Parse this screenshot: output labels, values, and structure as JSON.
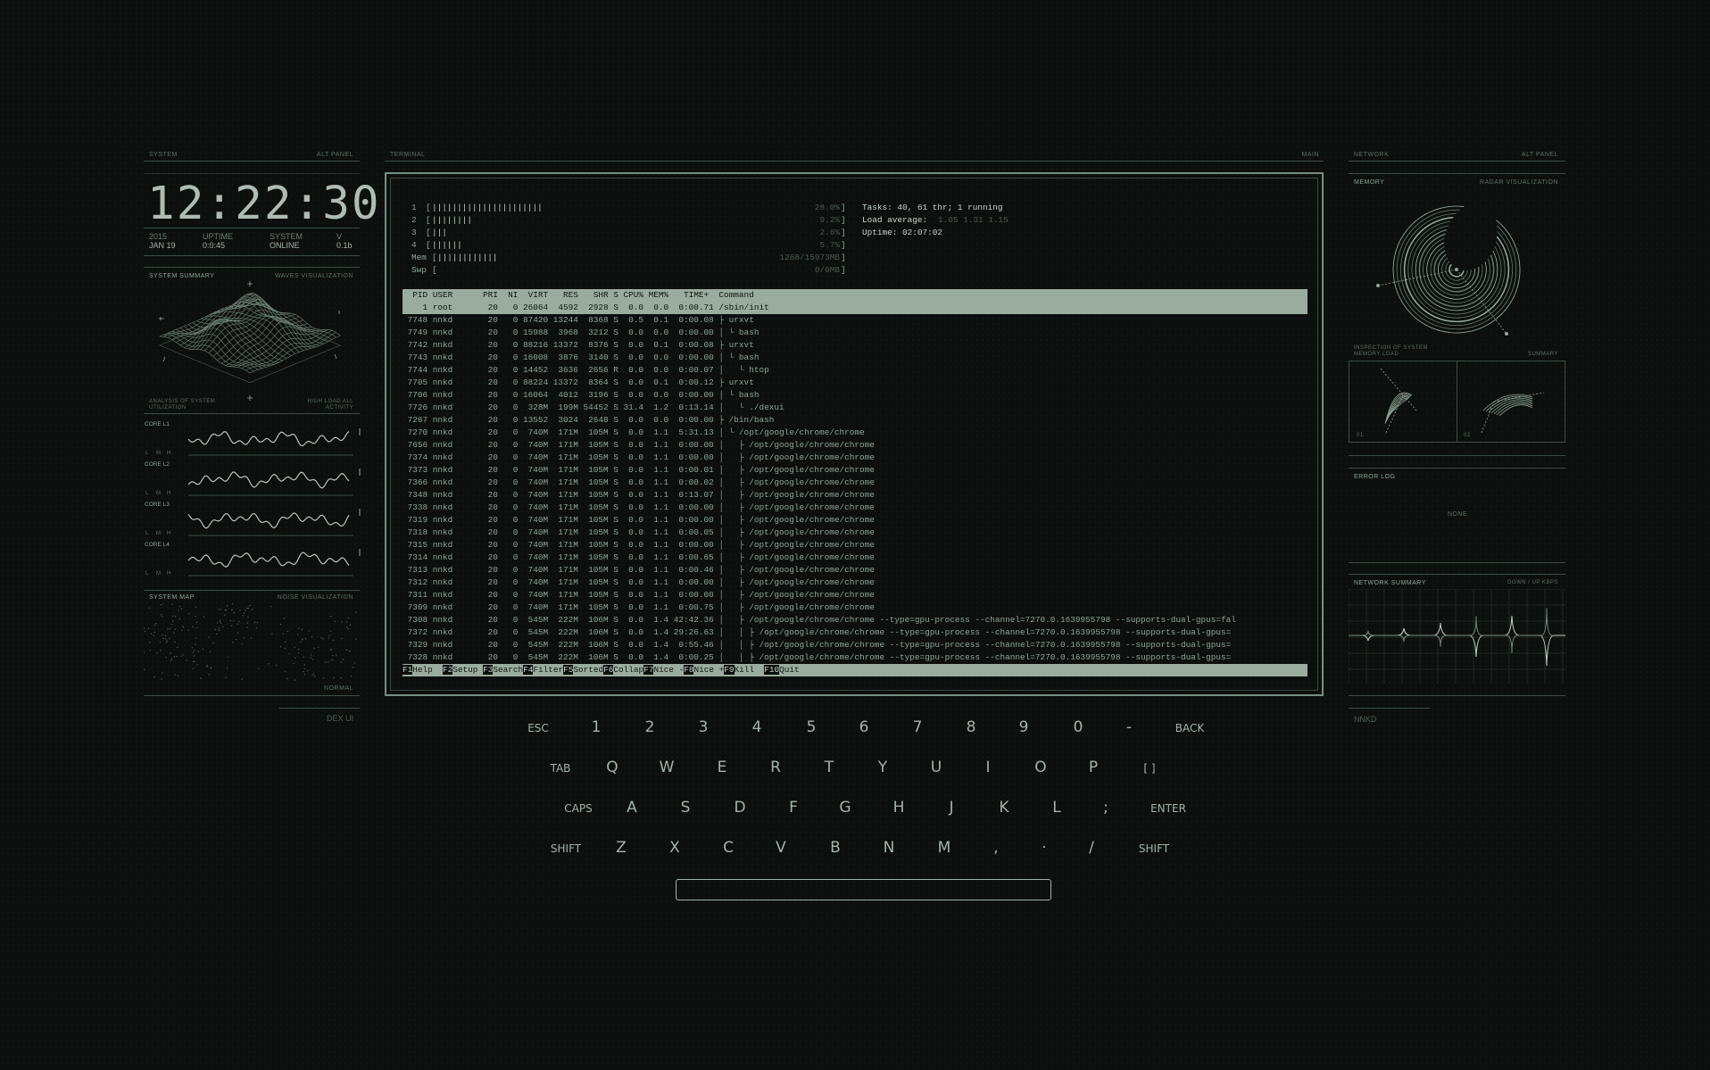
{
  "left_panel": {
    "header_left": "SYSTEM",
    "header_right": "ALT PANEL",
    "clock": "12:22:30",
    "info": [
      {
        "label": "2015",
        "value": "JAN 19"
      },
      {
        "label": "UPTIME",
        "value": "0:0:45"
      },
      {
        "label": "SYSTEM",
        "value": "ONLINE"
      },
      {
        "label": "V",
        "value": "0.1b"
      }
    ],
    "summary_title": "SYSTEM SUMMARY",
    "summary_right": "WAVES VISUALIZATION",
    "summary_foot_left": "ANALYSIS OF SYSTEM UTILIZATION",
    "summary_foot_right": "HIGH LOAD ALL ACTIVITY",
    "cores": [
      "CORE L1",
      "CORE L2",
      "CORE L3",
      "CORE L4"
    ],
    "lmh": [
      "L",
      "M",
      "H"
    ],
    "map_title": "SYSTEM MAP",
    "map_right": "NOISE VISUALIZATION",
    "map_foot": "NORMAL",
    "footer": "DEX UI"
  },
  "terminal": {
    "header_left": "TERMINAL",
    "header_right": "MAIN",
    "cpu_bars": [
      {
        "n": "1",
        "bar": "||||||||||||||||||||||",
        "pct": "28.0%"
      },
      {
        "n": "2",
        "bar": "||||||||",
        "pct": "9.2%"
      },
      {
        "n": "3",
        "bar": "|||",
        "pct": "2.6%"
      },
      {
        "n": "4",
        "bar": "||||||",
        "pct": "5.7%"
      }
    ],
    "mem": {
      "label": "Mem",
      "bar": "||||||||||||",
      "val": "1268/15973MB"
    },
    "swp": {
      "label": "Swp",
      "bar": "",
      "val": "0/0MB"
    },
    "tasks": "Tasks: 40, 61 thr; 1 running",
    "load_label": "Load average:",
    "load_vals": "1.05 1.31 1.15",
    "uptime": "Uptime: 02:07:02",
    "columns": "  PID USER      PRI  NI  VIRT   RES   SHR S CPU% MEM%   TIME+  Command",
    "rows": [
      "    1 root       20   0 26064  4592  2928 S  0.0  0.0  0:00.71 /sbin/init",
      " 7748 nnkd       20   0 87420 13244  8368 S  0.5  0.1  0:00.08 ├ urxvt",
      " 7749 nnkd       20   0 15988  3968  3212 S  0.0  0.0  0:00.00 │ └ bash",
      " 7742 nnkd       20   0 88216 13372  8376 S  0.0  0.1  0:00.08 ├ urxvt",
      " 7743 nnkd       20   0 16008  3876  3140 S  0.0  0.0  0:00.00 │ └ bash",
      " 7744 nnkd       20   0 14452  3636  2656 R  0.0  0.0  0:00.07 │   └ htop",
      " 7705 nnkd       20   0 88224 13372  8364 S  0.0  0.1  0:00.12 ├ urxvt",
      " 7706 nnkd       20   0 16064  4012  3196 S  0.0  0.0  0:00.00 │ └ bash",
      " 7726 nnkd       20   0  328M  199M 54452 S 31.4  1.2  0:13.14 │   └ ./dexui",
      " 7267 nnkd       20   0 13552  3024  2648 S  0.0  0.0  0:00.00 ├ /bin/bash",
      " 7270 nnkd       20   0  740M  171M  105M S  0.0  1.1  5:31.13 │ └ /opt/google/chrome/chrome",
      " 7656 nnkd       20   0  740M  171M  105M S  0.0  1.1  0:00.00 │   ├ /opt/google/chrome/chrome",
      " 7374 nnkd       20   0  740M  171M  105M S  0.0  1.1  0:00.00 │   ├ /opt/google/chrome/chrome",
      " 7373 nnkd       20   0  740M  171M  105M S  0.0  1.1  0:00.01 │   ├ /opt/google/chrome/chrome",
      " 7366 nnkd       20   0  740M  171M  105M S  0.0  1.1  0:00.02 │   ├ /opt/google/chrome/chrome",
      " 7348 nnkd       20   0  740M  171M  105M S  0.0  1.1  0:13.07 │   ├ /opt/google/chrome/chrome",
      " 7338 nnkd       20   0  740M  171M  105M S  0.0  1.1  0:00.00 │   ├ /opt/google/chrome/chrome",
      " 7319 nnkd       20   0  740M  171M  105M S  0.0  1.1  0:00.00 │   ├ /opt/google/chrome/chrome",
      " 7318 nnkd       20   0  740M  171M  105M S  0.0  1.1  0:00.05 │   ├ /opt/google/chrome/chrome",
      " 7315 nnkd       20   0  740M  171M  105M S  0.0  1.1  0:00.00 │   ├ /opt/google/chrome/chrome",
      " 7314 nnkd       20   0  740M  171M  105M S  0.0  1.1  0:00.65 │   ├ /opt/google/chrome/chrome",
      " 7313 nnkd       20   0  740M  171M  105M S  0.0  1.1  0:00.46 │   ├ /opt/google/chrome/chrome",
      " 7312 nnkd       20   0  740M  171M  105M S  0.0  1.1  0:00.00 │   ├ /opt/google/chrome/chrome",
      " 7311 nnkd       20   0  740M  171M  105M S  0.0  1.1  0:00.00 │   ├ /opt/google/chrome/chrome",
      " 7309 nnkd       20   0  740M  171M  105M S  0.0  1.1  0:00.75 │   ├ /opt/google/chrome/chrome",
      " 7308 nnkd       20   0  545M  222M  106M S  0.0  1.4 42:42.36 │   ├ /opt/google/chrome/chrome --type=gpu-process --channel=7270.0.1639955798 --supports-dual-gpus=fal",
      " 7372 nnkd       20   0  545M  222M  106M S  0.0  1.4 29:26.63 │   │ ├ /opt/google/chrome/chrome --type=gpu-process --channel=7270.0.1639955798 --supports-dual-gpus=",
      " 7329 nnkd       20   0  545M  222M  106M S  0.0  1.4  0:55.46 │   │ ├ /opt/google/chrome/chrome --type=gpu-process --channel=7270.0.1639955798 --supports-dual-gpus=",
      " 7328 nnkd       20   0  545M  222M  106M S  0.0  1.4  0:00.25 │   │ ├ /opt/google/chrome/chrome --type=gpu-process --channel=7270.0.1639955798 --supports-dual-gpus="
    ],
    "fkeys": [
      {
        "k": "F1",
        "l": "Help  "
      },
      {
        "k": "F2",
        "l": "Setup "
      },
      {
        "k": "F3",
        "l": "Search"
      },
      {
        "k": "F4",
        "l": "Filter"
      },
      {
        "k": "F5",
        "l": "Sorted"
      },
      {
        "k": "F6",
        "l": "Collap"
      },
      {
        "k": "F7",
        "l": "Nice -"
      },
      {
        "k": "F8",
        "l": "Nice +"
      },
      {
        "k": "F9",
        "l": "Kill  "
      },
      {
        "k": "F10",
        "l": "Quit  "
      }
    ]
  },
  "keyboard": {
    "row1": [
      "ESC",
      "1",
      "2",
      "3",
      "4",
      "5",
      "6",
      "7",
      "8",
      "9",
      "0",
      "-",
      "BACK"
    ],
    "row2": [
      "TAB",
      "Q",
      "W",
      "E",
      "R",
      "T",
      "Y",
      "U",
      "I",
      "O",
      "P",
      "[ ]"
    ],
    "row3": [
      "CAPS",
      "A",
      "S",
      "D",
      "F",
      "G",
      "H",
      "J",
      "K",
      "L",
      ";",
      "ENTER"
    ],
    "row4": [
      "SHIFT",
      "Z",
      "X",
      "C",
      "V",
      "B",
      "N",
      "M",
      ",",
      "·",
      "/",
      "SHIFT"
    ]
  },
  "right_panel": {
    "header_left": "NETWORK",
    "header_right": "ALT PANEL",
    "memory_title": "MEMORY",
    "memory_right": "RADAR VISUALIZATION",
    "memory_foot_left": "INSPECTION OF SYSTEM MEMORY LOAD",
    "memory_foot_right": "SUMMARY",
    "mini_labels": [
      "01",
      "02"
    ],
    "error_title": "ERROR LOG",
    "error_value": "NONE",
    "net_title": "NETWORK SUMMARY",
    "net_right": "DOWN / UP KBPS",
    "footer": "NNKD"
  },
  "colors": {
    "accent": "#9aac9f",
    "text": "#8fa699",
    "bg": "#0b0f0d"
  }
}
